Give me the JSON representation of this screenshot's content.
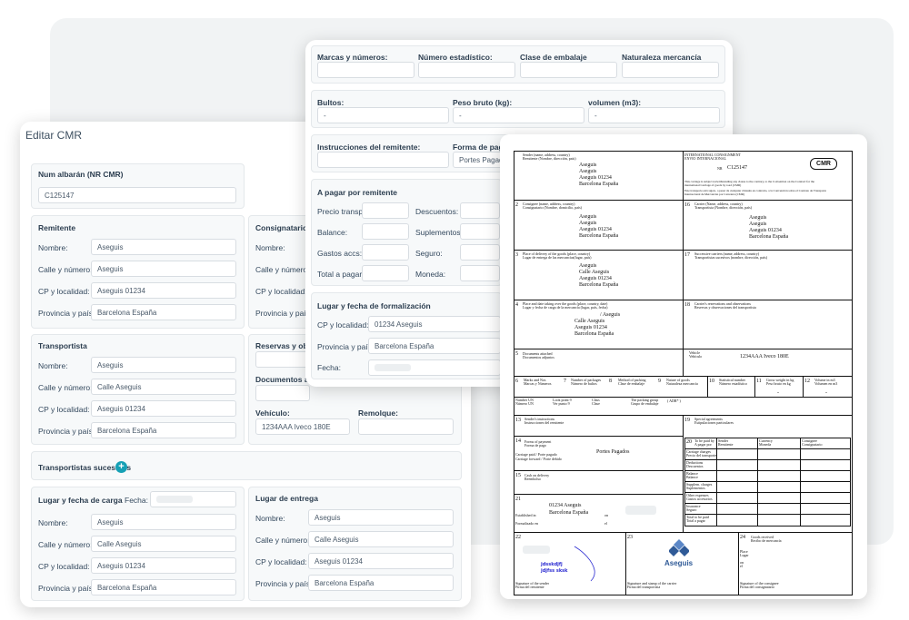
{
  "form": {
    "title": "Editar CMR",
    "albaran": {
      "label": "Num albarán (NR CMR)",
      "value": "C125147"
    },
    "remitente": {
      "heading": "Remitente",
      "nombre_label": "Nombre:",
      "nombre": "Aseguis",
      "calle_label": "Calle y número:",
      "calle": "Aseguis",
      "cp_label": "CP y localidad:",
      "cp": "Aseguis 01234",
      "prov_label": "Provincia y país:",
      "prov": "Barcelona España"
    },
    "consignatario": {
      "heading": "Consignatario",
      "nombre_label": "Nombre:",
      "calle_label": "Calle y número:",
      "cp_label": "CP y localidad:",
      "prov_label": "Provincia y país:"
    },
    "transportista": {
      "heading": "Transportista",
      "nombre_label": "Nombre:",
      "nombre": "Aseguis",
      "calle_label": "Calle y número:",
      "calle": "Calle Aseguis",
      "cp_label": "CP y localidad:",
      "cp": "Aseguis 01234",
      "prov_label": "Provincia y país:",
      "prov": "Barcelona España"
    },
    "reservas_label": "Reservas y obse",
    "documentos_label": "Documentos adj",
    "vehiculo_label": "Vehículo:",
    "vehiculo": "1234AAA Iveco 180E",
    "remolque_label": "Remolque:",
    "sucesivos_label": "Transportistas sucesivos",
    "plus_symbol": "+",
    "lugar_carga": {
      "heading": "Lugar y fecha de carga",
      "fecha_label": "Fecha:",
      "nombre_label": "Nombre:",
      "nombre": "Aseguis",
      "calle_label": "Calle y número:",
      "calle": "Calle Aseguis",
      "cp_label": "CP y localidad:",
      "cp": "Aseguis 01234",
      "prov_label": "Provincia y país:",
      "prov": "Barcelona España"
    },
    "lugar_entrega": {
      "heading": "Lugar de entrega",
      "nombre_label": "Nombre:",
      "nombre": "Aseguis",
      "calle_label": "Calle y número:",
      "calle": "Calle Aseguis",
      "cp_label": "CP y localidad:",
      "cp": "Aseguis 01234",
      "prov_label": "Provincia y país:",
      "prov": "Barcelona España"
    }
  },
  "goods": {
    "marcas_label": "Marcas y números:",
    "estadistico_label": "Número estadístico:",
    "embalaje_label": "Clase de embalaje",
    "naturaleza_label": "Naturaleza mercancía",
    "bultos_label": "Bultos:",
    "bultos": "-",
    "peso_label": "Peso bruto (kg):",
    "peso": "-",
    "volumen_label": "volumen (m3):",
    "volumen": "-",
    "instrucciones_label": "Instrucciones del remitente:",
    "forma_pago_label": "Forma de pago (I",
    "forma_pago": "Portes Pagados",
    "pagar_heading": "A pagar por remitente",
    "precio_label": "Precio transp:",
    "descuentos_label": "Descuentos:",
    "balance_label": "Balance:",
    "suplementos_label": "Suplementos:",
    "gastos_label": "Gastos accs:",
    "seguro_label": "Seguro:",
    "total_label": "Total a pagar:",
    "moneda_label": "Moneda:",
    "formalizacion_heading": "Lugar y fecha de formalización",
    "cp_label": "CP y localidad:",
    "cp": "01234 Aseguis",
    "prov_label": "Provincia y país:",
    "prov": "Barcelona España",
    "fecha_label": "Fecha:"
  },
  "cmr_doc": {
    "b1_title": "Sender (name, address, country)",
    "b1_sub": "Remitente (Nombre, dirección, país)",
    "b1_l1": "Aseguis",
    "b1_l2": "Aseguis",
    "b1_l3": "Aseguis 01234",
    "b1_l4": "Barcelona España",
    "hdr_1": "INTERNATIONAL CONSIGNMENT",
    "hdr_2": "ENVIO INTERNACIONAL",
    "nr_label": "NR",
    "nr": "C125147",
    "badge": "CMR",
    "hdr_t1": "This carriage is subject notwithstanding any clause to the contrary, to the Convention on the Contract for the",
    "hdr_t2": "international Carriage of goods by road (CMR)",
    "hdr_t3": "Este transporte está sujeto, a pesar de cualquier cláusula en contrario, a la Convención sobre el Contrato de Transporte",
    "hdr_t4": "Internacional de Mercancías por Carretera (CMR)",
    "n2": "2",
    "b2_title": "Consignee (name, address, country)",
    "b2_sub": "Consignatario (Nombre, domicilio, país)",
    "b2_l1": "Aseguis",
    "b2_l2": "Aseguis",
    "b2_l3": "Aseguis 01234",
    "b2_l4": "Barcelona España",
    "n16": "16",
    "b16_title": "Carrier (Name, address, country)",
    "b16_sub": "Transportista (Nombre, dirección, país)",
    "b16_l1": "Aseguis",
    "b16_l2": "Aseguis",
    "b16_l3": "Aseguis 01234",
    "b16_l4": "Barcelona España",
    "n3": "3",
    "b3_title": "Place of delivery of the goods (place, country)",
    "b3_sub": "Lugar de entrega de las mercancías(lugar, país)",
    "b3_l1": "Aseguis",
    "b3_l2": "Calle Aseguis",
    "b3_l3": "Aseguis 01234",
    "b3_l4": "Barcelona España",
    "n17": "17",
    "b17_title": "Successive carriers (name, address, country)",
    "b17_sub": "Transportistas sucesivos (nombre, dirección, país)",
    "n4": "4",
    "b4_title": "Place and date taking over the goods (place, country, date)",
    "b4_sub": "Lugar y fecha de carga de la mercancía (lugar, país, fecha)",
    "b4_l1": "/ Aseguis",
    "b4_l2": "Calle Aseguis",
    "b4_l3": "Aseguis 01234",
    "b4_l4": "Barcelona España",
    "n18": "18",
    "b18_title": "Carrier's reservations and observations",
    "b18_sub": "Reservas y observaciones del transportista",
    "n5": "5",
    "b5_title": "Documents attached",
    "b5_sub": "Documentos adjuntos",
    "veh_title": "Vehicle",
    "veh_sub": "Vehículo",
    "veh_val": "1234AAA Iveco 180E",
    "n6": "6",
    "c6": "Marks and Nos",
    "c6s": "Marcas y Números",
    "n7": "7",
    "c7": "Number of packages",
    "c7s": "Número de bultos",
    "n8": "8",
    "c8": "Method of packing",
    "c8s": "Clase de embalaje",
    "n9": "9",
    "c9": "Nature of goods",
    "c9s": "Naturaleza mercancía",
    "n10": "10",
    "c10": "Statistical number",
    "c10s": "Número estadístico",
    "n11": "11",
    "c11": "Gross weight in kg",
    "c11s": "Peso bruto en kg",
    "n12": "12",
    "c12": "Volume in m3",
    "c12s": "Volumen en m3",
    "dash": "-",
    "un1": "Number UN",
    "un1s": "Número UN",
    "un2": "Look point 9",
    "un2s": "Ver punto 9",
    "un3": "Class",
    "un3s": "Clase",
    "un4": "The packing group",
    "un4s": "Grupo de embalaje",
    "un5": "( ADR* )",
    "n13": "13",
    "b13_title": "Sender's instructions",
    "b13_sub": "Instrucciones del remitente",
    "n19": "19",
    "b19_title": "Special agreements",
    "b19_sub": "Estipulaciones particulares",
    "n14": "14",
    "b14_title": "Forms of payment",
    "b14_sub": "Forma de pago",
    "b14_c1": "Carriage paid / Porte pagado",
    "b14_c2": "Carriage forward / Porte debido",
    "b14_val": "Portes Pagados",
    "n20": "20",
    "b20_title": "To be paid by",
    "b20_sub": "A pagar por",
    "b20_sender": "Sender",
    "b20_sender_s": "Remitente",
    "b20_cur": "Currency",
    "b20_cur_s": "Moneda",
    "b20_cons": "Consignee",
    "b20_cons_s": "Consignatario",
    "p1": "Carriage charges",
    "p1s": "Precio del transporte",
    "p2": "Deductions",
    "p2s": "Descuentos",
    "p3": "Balance",
    "p3s": "Balance",
    "p4": "Supplem. charges",
    "p4s": "Suplementos",
    "p5": "Other expenses",
    "p5s": "Gastos accesorios",
    "p6": "Insurance",
    "p6s": "Seguro",
    "p7": "Total to be paid",
    "p7s": "Total a pagar",
    "n15": "15",
    "b15_title": "Cash on delivery",
    "b15_sub": "Reembolso",
    "n21": "21",
    "b21_l1": "01234 Aseguis",
    "b21_l2": "Barcelona España",
    "b21_a": "Established in",
    "b21_b": "Formalizado en",
    "b21_on": "on",
    "b21_el": "el",
    "n22": "22",
    "n23": "23",
    "n24": "24",
    "b24_title": "Goods received",
    "b24_sub": "Recibo de mercancía",
    "b24_place": "Place",
    "b24_lugar": "Lugar",
    "b24_on": "on",
    "b24_el": "el",
    "sig_text1": "jdsskdjfj",
    "sig_text2": "jdjfss sksk",
    "s22_t": "Signature of the sender",
    "s22_s": "Firma del remitente",
    "s23_t": "Signature and stamp of the carrier",
    "s23_s": "Firma del transportista",
    "s24_t": "Signature of the consignee",
    "s24_s": "Firma del consignatario",
    "logo_text": "Aseguis"
  }
}
